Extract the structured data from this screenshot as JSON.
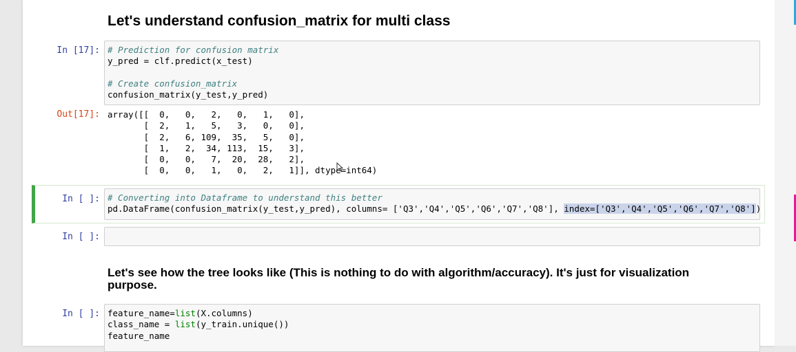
{
  "headings": {
    "h1": "Let's understand confusion_matrix for multi class",
    "h2": "Let's see how the tree looks like (This is nothing to do with algorithm/accuracy). It's just for visualization purpose."
  },
  "cells": {
    "c17": {
      "prompt": "In [17]:",
      "comment1": "# Prediction for confusion matrix",
      "line2": "y_pred = clf.predict(x_test)",
      "comment2": "# Create confusion_matrix",
      "line4": "confusion_matrix(y_test,y_pred)"
    },
    "out17": {
      "prompt": "Out[17]:",
      "rows": [
        "array([[  0,   0,   2,   0,   1,   0],",
        "       [  2,   1,   5,   3,   0,   0],",
        "       [  2,   6, 109,  35,   5,   0],",
        "       [  1,   2,  34, 113,  15,   3],",
        "       [  0,   0,   7,  20,  28,   2],",
        "       [  0,   0,   1,   0,   2,   1]], dtype=int64)"
      ]
    },
    "cDF": {
      "prompt": "In [ ]:",
      "comment": "# Converting into Dataframe to understand this better",
      "code_a": "pd.DataFrame(confusion_matrix(y_test,y_pred), columns= ['Q3','Q4','Q5','Q6','Q7','Q8'], ",
      "code_b": "index=['Q3','Q4','Q5','Q6','Q7','Q8']",
      "code_c": ")"
    },
    "cEmpty": {
      "prompt": "In [ ]:"
    },
    "cTree": {
      "prompt": "In [ ]:",
      "line1a": "feature_name=",
      "line1b": "list",
      "line1c": "(X.columns)",
      "line2a": "class_name = ",
      "line2b": "list",
      "line2c": "(y_train.unique())",
      "line3": "feature_name"
    }
  },
  "colors": {
    "prompt_in": "#303f9f",
    "prompt_out": "#d84315",
    "selected_border": "#42a547",
    "comment": "#408080"
  }
}
